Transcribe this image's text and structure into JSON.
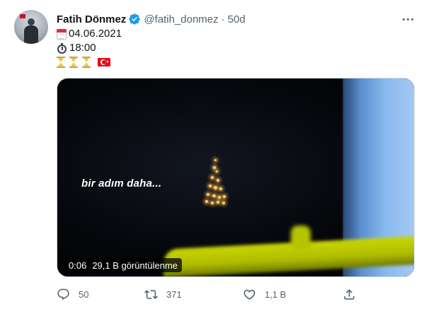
{
  "tweet": {
    "author": {
      "display_name": "Fatih Dönmez",
      "handle": "@fatih_donmez",
      "verified": true,
      "avatar_icon": "avatar-photo-icon"
    },
    "separator": "·",
    "timestamp": "50d",
    "more_icon": "more-horizontal-icon",
    "lines": {
      "date": {
        "icon": "calendar-icon",
        "text": "04.06.2021"
      },
      "time": {
        "icon": "stopwatch-icon",
        "text": "18:00"
      },
      "emoji_row": {
        "icons": [
          "hourglass-icon",
          "hourglass-icon",
          "hourglass-icon",
          "turkey-flag-icon"
        ]
      }
    },
    "media": {
      "type": "video",
      "overlay_text": "bir adım daha...",
      "duration": "0:06",
      "views": "29,1 B görüntülenme"
    },
    "actions": {
      "reply": {
        "icon": "reply-icon",
        "count": "50"
      },
      "retweet": {
        "icon": "retweet-icon",
        "count": "371"
      },
      "like": {
        "icon": "heart-icon",
        "count": "1,1 B"
      },
      "share": {
        "icon": "share-icon",
        "count": ""
      }
    }
  },
  "colors": {
    "text_primary": "#0f1419",
    "text_secondary": "#536471",
    "verified_blue": "#1d9bf0",
    "media_border": "#cfd9de"
  }
}
